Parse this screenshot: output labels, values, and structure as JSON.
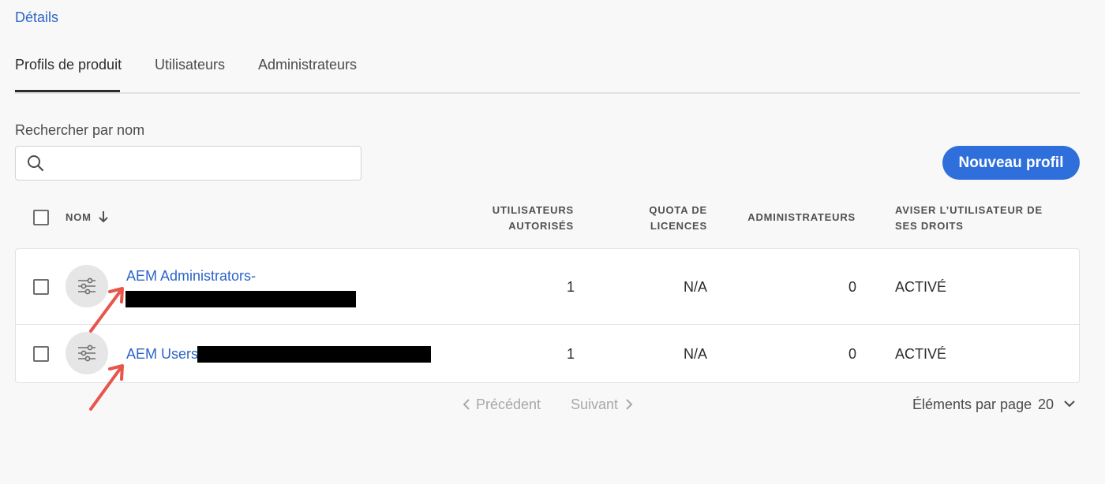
{
  "breadcrumb": {
    "details_link": "Détails"
  },
  "tabs": [
    {
      "label": "Profils de produit",
      "active": true
    },
    {
      "label": "Utilisateurs",
      "active": false
    },
    {
      "label": "Administrateurs",
      "active": false
    }
  ],
  "search": {
    "label": "Rechercher par nom",
    "value": "",
    "placeholder": ""
  },
  "actions": {
    "new_profile_label": "Nouveau profil"
  },
  "table": {
    "headers": {
      "name": "NOM",
      "users_line1": "UTILISATEURS",
      "users_line2": "AUTORISÉS",
      "quota_line1": "QUOTA DE",
      "quota_line2": "LICENCES",
      "admins": "ADMINISTRATEURS",
      "notify_line1": "AVISER L’UTILISATEUR DE",
      "notify_line2": "SES DROITS"
    },
    "rows": [
      {
        "name": "AEM Administrators-",
        "users": "1",
        "quota": "N/A",
        "admins": "0",
        "notify": "ACTIVÉ"
      },
      {
        "name": "AEM Users-",
        "users": "1",
        "quota": "N/A",
        "admins": "0",
        "notify": "ACTIVÉ"
      }
    ]
  },
  "pagination": {
    "previous_label": "Précédent",
    "next_label": "Suivant",
    "per_page_label": "Éléments par page",
    "per_page_value": "20"
  },
  "colors": {
    "accent": "#2f6fdc",
    "link": "#2c63c9",
    "annotation_arrow": "#e8554a"
  }
}
